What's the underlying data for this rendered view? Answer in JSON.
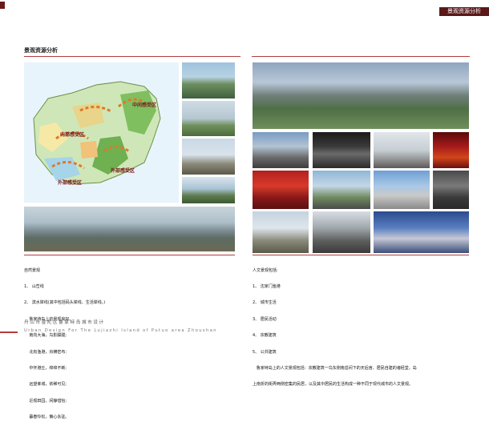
{
  "header": {
    "badge_label": "景观资源分析"
  },
  "section": {
    "title": "景观资源分析"
  },
  "map": {
    "zone_labels": [
      "中间感受区",
      "内部感受区",
      "外部感受区",
      "外部感受区"
    ]
  },
  "left_notes": {
    "heading": "自然景观",
    "lines": [
      "1、 山峦线",
      "2、 滨水岸线(其中包括码头岸线、生活岸线。)",
      "    鲁家峙岛上的景观良好。",
      "    南向大海，鸟影朦胧;",
      "    北有渔港，舟横密布;",
      "    中怀港丘，绵绵不断;",
      "    远望孝城，依稀可见;",
      "    近观田园，闲静惜怡;",
      "    暮春怜松，懒心永驻。"
    ]
  },
  "right_notes": {
    "heading": "人文景观包括:",
    "items": [
      "1、 沈家门渔港",
      "2、 城市生活",
      "3、 居民活动",
      "4、 宗教建筑",
      "5、 公共建筑"
    ],
    "paragraph_1": "   鲁家峙岛上的人文景观包括：宗教建筑一鸟东侧南岳间下的天后宫、居民自建的诸经堂。岛",
    "paragraph_2": "上南折的街弄两侧密集的民居，以及其中居民的生活构成一种不同于现代城市的人文景观。"
  },
  "footer": {
    "cn": "舟山市普陀区鲁家峙岛城市设计",
    "en": "Urban Design For The Lujiazhi Island of Putuo area Zhoushan"
  }
}
